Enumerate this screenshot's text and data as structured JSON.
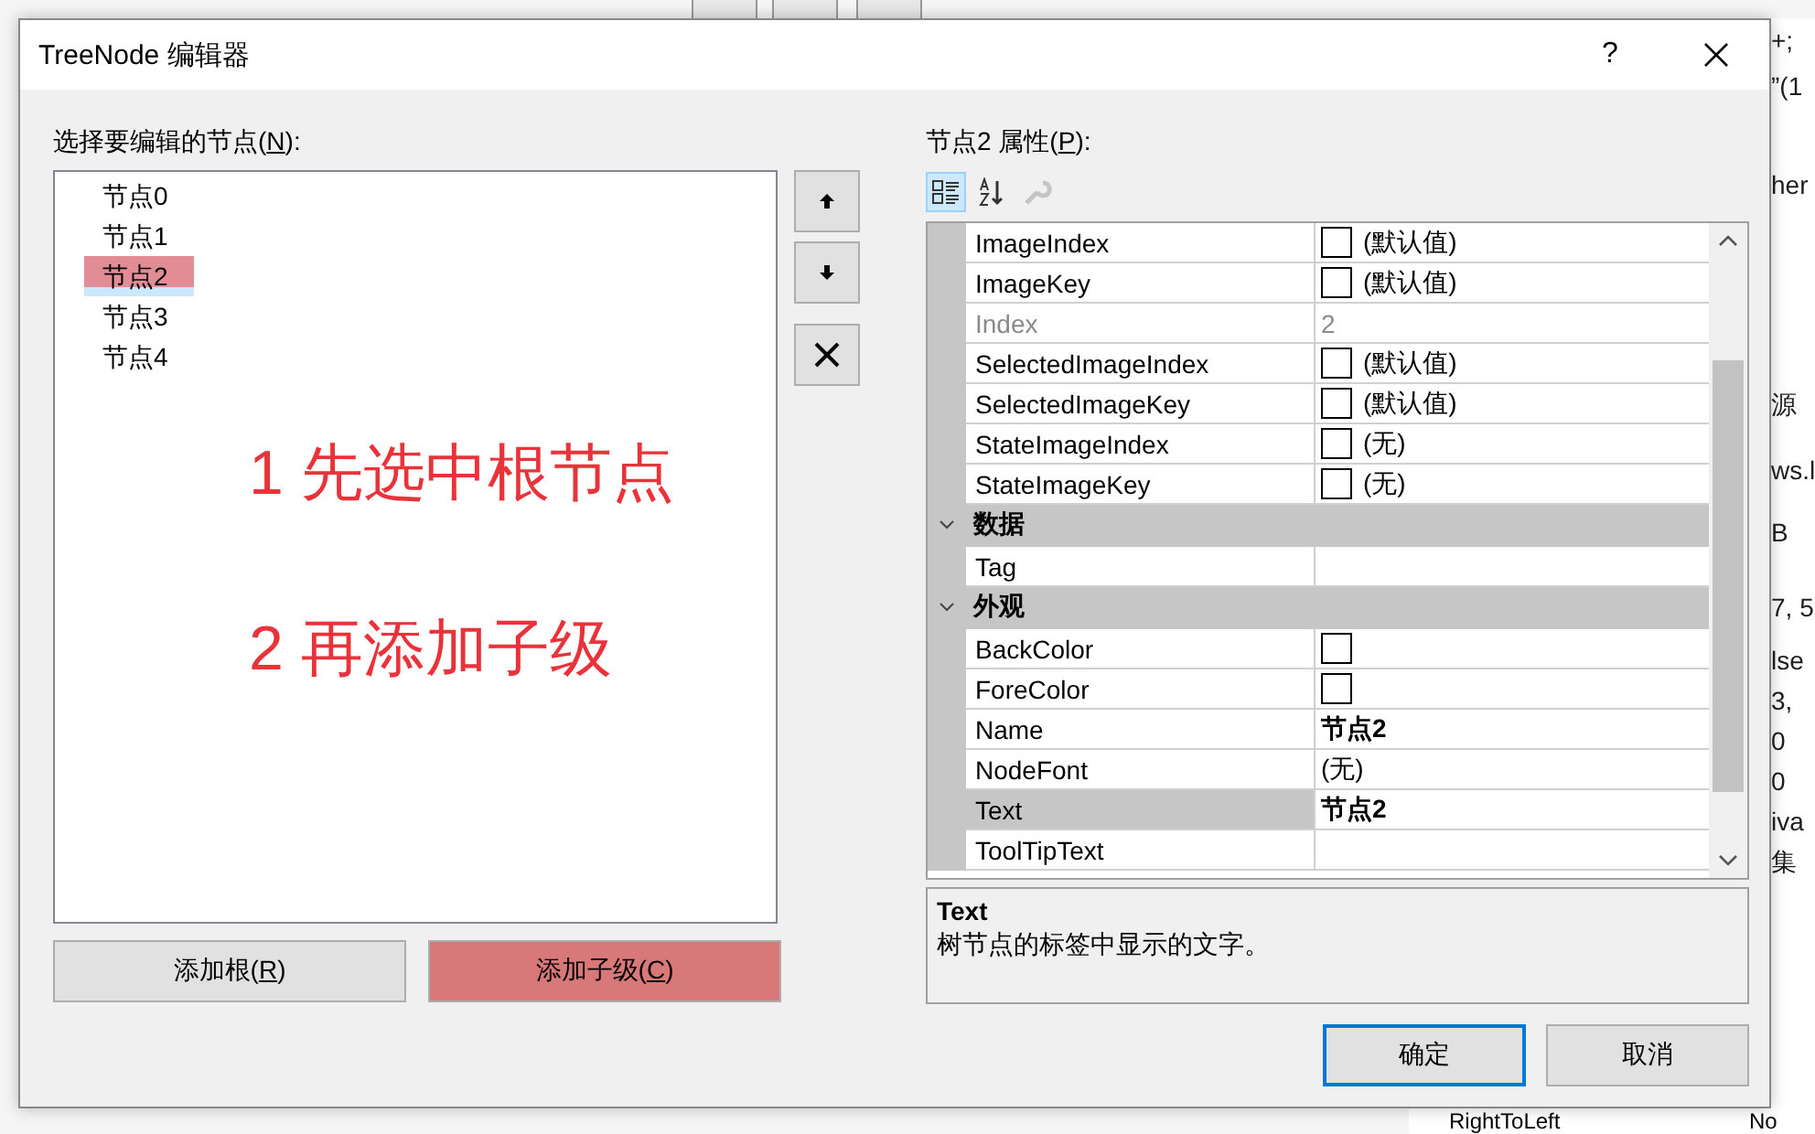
{
  "background": {
    "fragments": [
      {
        "text": "+;"
      },
      {
        "text": "”(1"
      },
      {
        "text": "her"
      },
      {
        "text": "源"
      },
      {
        "text": "ws.l"
      },
      {
        "text": "B"
      },
      {
        "text": "7, 5"
      },
      {
        "text": "lse"
      },
      {
        "text": "3,"
      },
      {
        "text": "0"
      },
      {
        "text": "0"
      },
      {
        "text": "iva"
      },
      {
        "text": "集"
      }
    ],
    "bottom_row": {
      "name": "RightToLeft",
      "value": "No"
    }
  },
  "dialog": {
    "title": "TreeNode 编辑器",
    "help": "?",
    "tree": {
      "label": {
        "before": "选择要编辑的节点(",
        "key": "N",
        "after": "):"
      },
      "nodes": [
        {
          "label": "节点0",
          "selected": false,
          "highlighted": false
        },
        {
          "label": "节点1",
          "selected": false,
          "highlighted": false
        },
        {
          "label": "节点2",
          "selected": true,
          "highlighted": true
        },
        {
          "label": "节点3",
          "selected": false,
          "highlighted": false
        },
        {
          "label": "节点4",
          "selected": false,
          "highlighted": false
        }
      ],
      "annotations": [
        {
          "text": "1 先选中根节点"
        },
        {
          "text": "2 再添加子级"
        }
      ],
      "side_buttons": [
        {
          "kind": "up"
        },
        {
          "kind": "down"
        },
        {
          "kind": "delete"
        }
      ],
      "buttons": [
        {
          "before": "添加根(",
          "key": "R",
          "after": ")",
          "highlighted": false
        },
        {
          "before": "添加子级(",
          "key": "C",
          "after": ")",
          "highlighted": true
        }
      ]
    },
    "properties": {
      "label": {
        "before": "节点2 属性(",
        "key": "P",
        "after": "):"
      },
      "toolbar": [
        {
          "kind": "categorized",
          "selected": true,
          "disabled": false
        },
        {
          "kind": "alphabetical",
          "selected": false,
          "disabled": false
        },
        {
          "kind": "pages",
          "selected": false,
          "disabled": true
        }
      ],
      "rows": [
        {
          "kind": "property",
          "name": "ImageIndex",
          "value": "(默认值)",
          "swatch": true,
          "disabled": false,
          "selected": false,
          "modified": false
        },
        {
          "kind": "property",
          "name": "ImageKey",
          "value": "(默认值)",
          "swatch": true,
          "disabled": false,
          "selected": false,
          "modified": false
        },
        {
          "kind": "property",
          "name": "Index",
          "value": "2",
          "disabled": true,
          "selected": false,
          "modified": false
        },
        {
          "kind": "property",
          "name": "SelectedImageIndex",
          "value": "(默认值)",
          "swatch": true,
          "disabled": false,
          "selected": false,
          "modified": false
        },
        {
          "kind": "property",
          "name": "SelectedImageKey",
          "value": "(默认值)",
          "swatch": true,
          "disabled": false,
          "selected": false,
          "modified": false
        },
        {
          "kind": "property",
          "name": "StateImageIndex",
          "value": "(无)",
          "swatch": true,
          "disabled": false,
          "selected": false,
          "modified": false
        },
        {
          "kind": "property",
          "name": "StateImageKey",
          "value": "(无)",
          "swatch": true,
          "disabled": false,
          "selected": false,
          "modified": false
        },
        {
          "kind": "category",
          "name": "数据",
          "expanded": true
        },
        {
          "kind": "property",
          "name": "Tag",
          "disabled": false,
          "selected": false
        },
        {
          "kind": "category",
          "name": "外观",
          "expanded": true
        },
        {
          "kind": "property",
          "name": "BackColor",
          "swatch": true,
          "disabled": false,
          "selected": false,
          "modified": false
        },
        {
          "kind": "property",
          "name": "ForeColor",
          "swatch": true,
          "disabled": false,
          "selected": false,
          "modified": false
        },
        {
          "kind": "property",
          "name": "Name",
          "value": "节点2",
          "disabled": false,
          "selected": false,
          "modified": true
        },
        {
          "kind": "property",
          "name": "NodeFont",
          "value": "(无)",
          "disabled": false,
          "selected": false,
          "modified": false
        },
        {
          "kind": "property",
          "name": "Text",
          "value": "节点2",
          "disabled": false,
          "selected": true,
          "modified": true
        },
        {
          "kind": "property",
          "name": "ToolTipText",
          "disabled": false,
          "selected": false
        }
      ],
      "description": {
        "title": "Text",
        "text": "树节点的标签中显示的文字。"
      }
    },
    "footer": [
      {
        "label": "确定",
        "default": true
      },
      {
        "label": "取消",
        "default": false
      }
    ]
  }
}
